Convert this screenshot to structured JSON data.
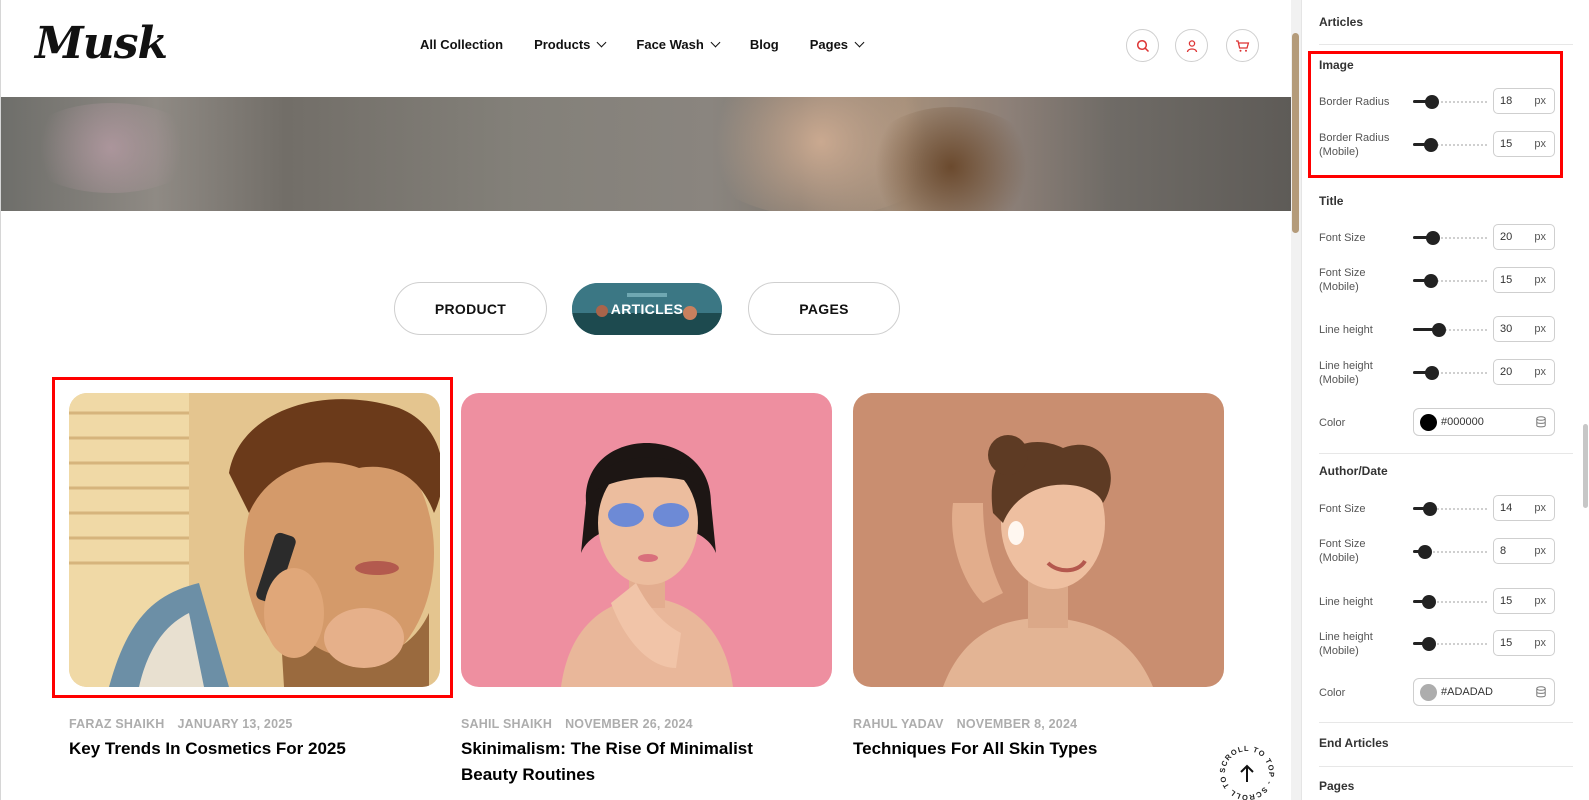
{
  "header": {
    "logo": "Musk",
    "nav": [
      {
        "label": "All Collection",
        "has_dropdown": false
      },
      {
        "label": "Products",
        "has_dropdown": true
      },
      {
        "label": "Face Wash",
        "has_dropdown": true
      },
      {
        "label": "Blog",
        "has_dropdown": false
      },
      {
        "label": "Pages",
        "has_dropdown": true
      }
    ],
    "icons": [
      "search-icon",
      "user-icon",
      "cart-icon"
    ]
  },
  "tabs": [
    {
      "label": "PRODUCT",
      "active": false
    },
    {
      "label": "ARTICLES",
      "active": true
    },
    {
      "label": "PAGES",
      "active": false
    }
  ],
  "articles": [
    {
      "author": "FARAZ SHAIKH",
      "date": "JANUARY 13, 2025",
      "title": "Key Trends In Cosmetics For 2025"
    },
    {
      "author": "SAHIL SHAIKH",
      "date": "NOVEMBER 26, 2024",
      "title": "Skinimalism: The Rise Of Minimalist Beauty Routines"
    },
    {
      "author": "RAHUL YADAV",
      "date": "NOVEMBER 8, 2024",
      "title": "Techniques For All Skin Types"
    }
  ],
  "scroll_to_top": {
    "label": "SCROLL TO TOP - SCROLL TO TOP -"
  },
  "panel": {
    "top_section": "Articles",
    "image": {
      "title": "Image",
      "border_radius": {
        "label": "Border Radius",
        "value": "18",
        "unit": "px"
      },
      "border_radius_mobile": {
        "label": "Border Radius\n(Mobile)",
        "label1": "Border Radius",
        "label2": "(Mobile)",
        "value": "15",
        "unit": "px"
      }
    },
    "title_section": {
      "title": "Title",
      "font_size": {
        "label": "Font Size",
        "value": "20",
        "unit": "px"
      },
      "font_size_mobile": {
        "label1": "Font Size",
        "label2": "(Mobile)",
        "value": "15",
        "unit": "px"
      },
      "line_height": {
        "label": "Line height",
        "value": "30",
        "unit": "px"
      },
      "line_height_mobile": {
        "label1": "Line height",
        "label2": "(Mobile)",
        "value": "20",
        "unit": "px"
      },
      "color": {
        "label": "Color",
        "value": "#000000",
        "swatch": "#000000"
      }
    },
    "author_date": {
      "title": "Author/Date",
      "font_size": {
        "label": "Font Size",
        "value": "14",
        "unit": "px"
      },
      "font_size_mobile": {
        "label1": "Font Size",
        "label2": "(Mobile)",
        "value": "8",
        "unit": "px"
      },
      "line_height": {
        "label": "Line height",
        "value": "15",
        "unit": "px"
      },
      "line_height_mobile": {
        "label1": "Line height",
        "label2": "(Mobile)",
        "value": "15",
        "unit": "px"
      },
      "color": {
        "label": "Color",
        "value": "#ADADAD",
        "swatch": "#ADADAD"
      }
    },
    "end_section": "End Articles",
    "next_section": "Pages"
  },
  "colors": {
    "highlight": "#ff0000",
    "accent_icon": "#d33333",
    "meta_text": "#adadad"
  }
}
